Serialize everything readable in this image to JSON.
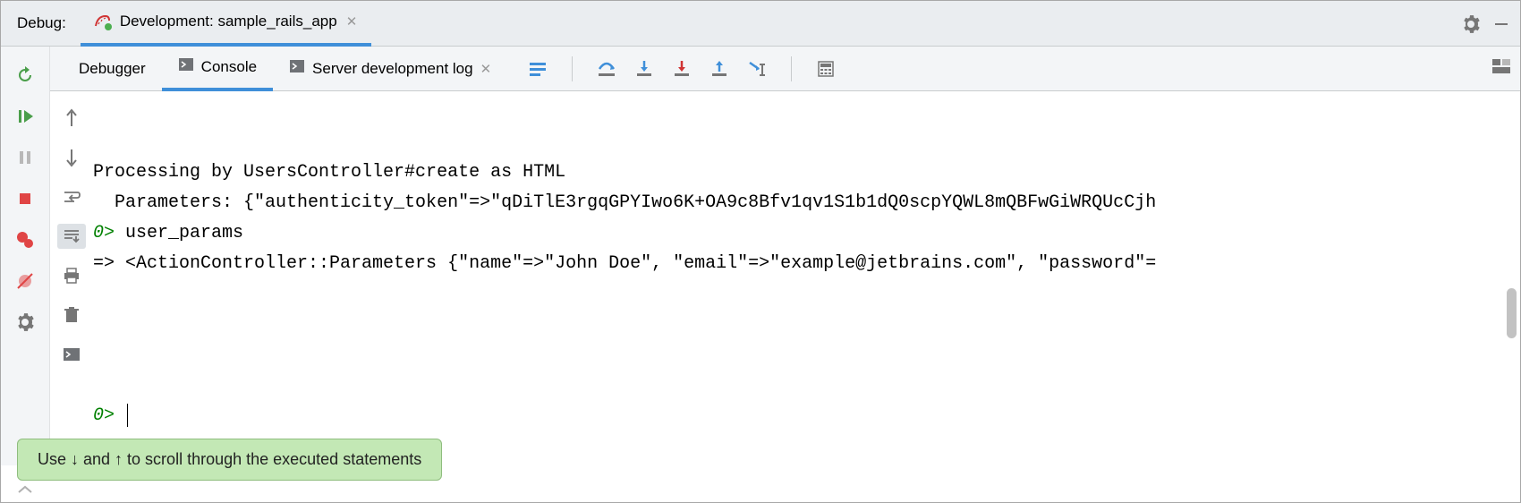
{
  "header": {
    "debug_label": "Debug:",
    "tab_title": "Development: sample_rails_app"
  },
  "tabs": [
    {
      "label": "Debugger",
      "active": false,
      "closable": false,
      "icon": null
    },
    {
      "label": "Console",
      "active": true,
      "closable": false,
      "icon": "console"
    },
    {
      "label": "Server development log",
      "active": false,
      "closable": true,
      "icon": "console"
    }
  ],
  "console": {
    "lines": [
      {
        "type": "plain",
        "text": "Processing by UsersController#create as HTML"
      },
      {
        "type": "plain",
        "text": "  Parameters: {\"authenticity_token\"=>\"qDiTlE3rgqGPYIwo6K+OA9c8Bfv1qv1S1b1dQ0scpYQWL8mQBFwGiWRQUcCjh"
      },
      {
        "type": "prompt_input",
        "num": "0",
        "text": " user_params"
      },
      {
        "type": "plain",
        "text": "=> <ActionController::Parameters {\"name\"=>\"John Doe\", \"email\"=>\"example@jetbrains.com\", \"password\"="
      },
      {
        "type": "blank",
        "text": ""
      },
      {
        "type": "blank",
        "text": ""
      },
      {
        "type": "blank",
        "text": ""
      },
      {
        "type": "blank",
        "text": ""
      },
      {
        "type": "prompt_cursor",
        "num": "0",
        "text": " "
      }
    ]
  },
  "hint": {
    "text": "Use ↓ and ↑ to scroll through the executed statements"
  },
  "left_toolbar": {
    "rerun": "Rerun",
    "resume": "Resume",
    "pause": "Pause",
    "stop": "Stop",
    "breakpoints": "View Breakpoints",
    "mute": "Mute Breakpoints",
    "settings": "Settings"
  },
  "step_buttons": {
    "show_exec": "Show Execution Point",
    "step_over": "Step Over",
    "step_into": "Step Into",
    "force_step": "Force Step Into",
    "step_out": "Step Out",
    "run_to_cursor": "Run to Cursor",
    "evaluate": "Evaluate Expression"
  },
  "console_toolbar": {
    "up": "Up",
    "down": "Down",
    "soft_wrap": "Use Soft Wraps",
    "scroll_end": "Scroll to End",
    "print": "Print",
    "clear": "Clear All",
    "new_console": "New Console"
  }
}
